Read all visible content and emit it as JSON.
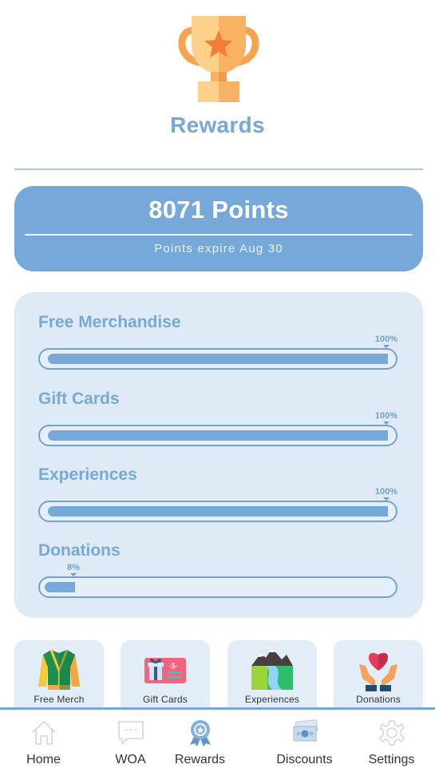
{
  "header": {
    "title": "Rewards",
    "icon": "trophy-icon"
  },
  "points": {
    "value_label": "8071 Points",
    "expiry_label": "Points expire Aug 30"
  },
  "categories": [
    {
      "title": "Free Merchandise",
      "progress_percent": 100,
      "progress_label": "100%"
    },
    {
      "title": "Gift Cards",
      "progress_percent": 100,
      "progress_label": "100%"
    },
    {
      "title": "Experiences",
      "progress_percent": 100,
      "progress_label": "100%"
    },
    {
      "title": "Donations",
      "progress_percent": 8,
      "progress_label": "8%"
    }
  ],
  "tiles": [
    {
      "label": "Free Merch",
      "icon": "jacket-icon"
    },
    {
      "label": "Gift Cards",
      "icon": "gift-card-icon"
    },
    {
      "label": "Experiences",
      "icon": "mountain-river-icon"
    },
    {
      "label": "Donations",
      "icon": "heart-hands-icon"
    }
  ],
  "tabbar": {
    "active": "Rewards",
    "items": [
      {
        "label": "Home",
        "icon": "home-icon"
      },
      {
        "label": "WOA",
        "icon": "chat-bubble-icon"
      },
      {
        "label": "Rewards",
        "icon": "award-ribbon-icon"
      },
      {
        "label": "Discounts",
        "icon": "cash-icon"
      },
      {
        "label": "Settings",
        "icon": "gear-icon"
      }
    ]
  },
  "colors": {
    "accent": "#76a9da",
    "card_bg": "#deebf6",
    "title": "#74a8d8",
    "tile_bg": "#e3edf7"
  }
}
